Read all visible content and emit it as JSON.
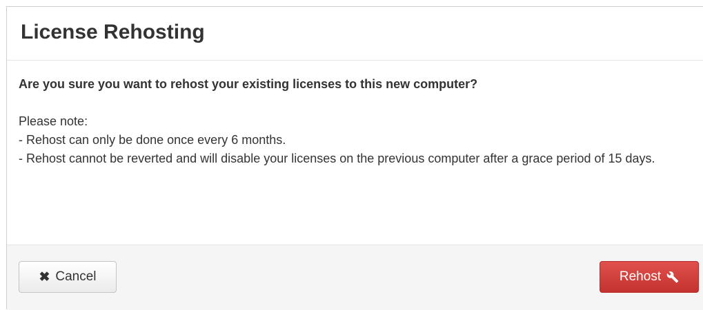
{
  "modal": {
    "title": "License Rehosting",
    "question": "Are you sure you want to rehost your existing licenses to this new computer?",
    "note_heading": "Please note:",
    "notes": [
      "- Rehost can only be done once every 6 months.",
      "- Rehost cannot be reverted and will disable your licenses on the previous computer after a grace period of 15 days."
    ]
  },
  "footer": {
    "cancel_label": "Cancel",
    "cancel_icon": "times-icon",
    "rehost_label": "Rehost",
    "rehost_icon": "wrench-icon"
  },
  "colors": {
    "danger": "#d43f3a",
    "footer_bg": "#f5f5f5",
    "text": "#333333"
  }
}
